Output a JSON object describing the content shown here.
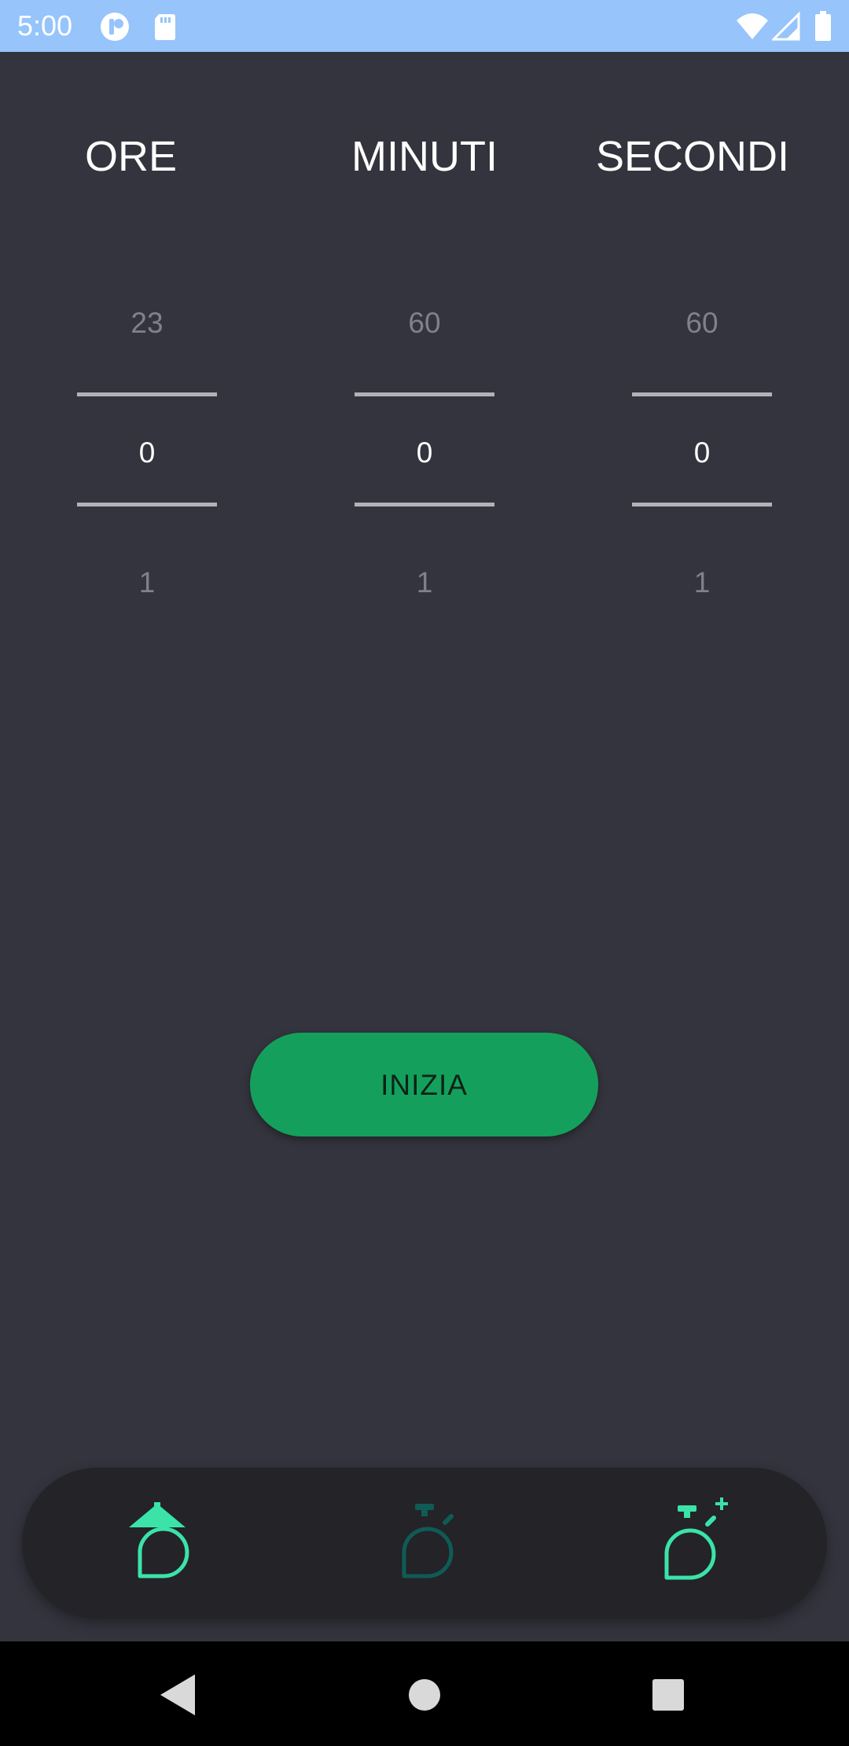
{
  "status_bar": {
    "time": "5:00",
    "icons": [
      "notification-icon",
      "sd-card-icon",
      "wifi-icon",
      "signal-icon",
      "battery-icon"
    ]
  },
  "timer": {
    "columns": [
      {
        "header": "ORE",
        "prev": "23",
        "current": "0",
        "next": "1"
      },
      {
        "header": "MINUTI",
        "prev": "60",
        "current": "0",
        "next": "1"
      },
      {
        "header": "SECONDI",
        "prev": "60",
        "current": "0",
        "next": "1"
      }
    ]
  },
  "start_button": {
    "label": "INIZIA",
    "color": "#14a05c"
  },
  "bottom_nav": {
    "items": [
      "home-timer-icon",
      "stopwatch-icon",
      "add-timer-icon"
    ],
    "active_color": "#3be3a8",
    "inactive_color": "#0f5b55"
  },
  "system_nav": {
    "buttons": [
      "back-icon",
      "home-icon",
      "recents-icon"
    ]
  },
  "colors": {
    "background": "#34343e",
    "status_bar": "#96c4fb"
  }
}
